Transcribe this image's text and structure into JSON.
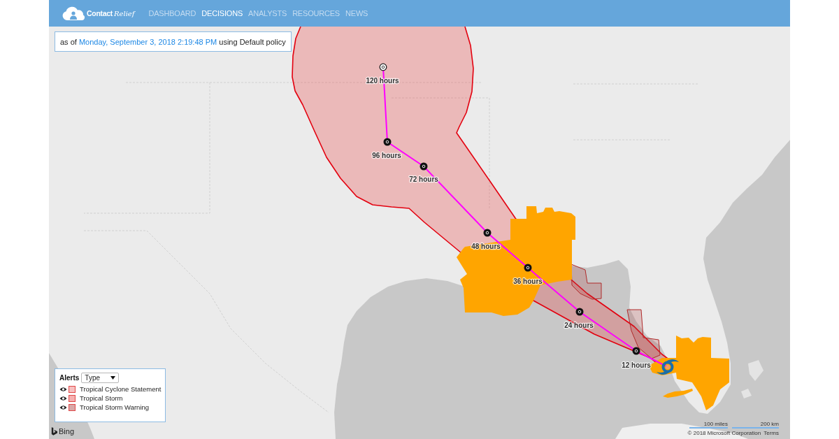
{
  "header": {
    "logo": {
      "first": "Contact",
      "second": "Relief"
    },
    "nav": [
      {
        "label": "DASHBOARD",
        "selected": false
      },
      {
        "label": "DECISIONS",
        "selected": true
      },
      {
        "label": "ANALYSTS",
        "selected": false
      },
      {
        "label": "RESOURCES",
        "selected": false
      },
      {
        "label": "NEWS",
        "selected": false
      }
    ]
  },
  "status": {
    "prefix": "as of",
    "timestamp": "Monday, September 3, 2018 2:19:48 PM",
    "suffix": "using Default policy"
  },
  "map": {
    "forecast_points": [
      {
        "label": "120 hours",
        "kind": "depression"
      },
      {
        "label": "96 hours",
        "kind": "storm"
      },
      {
        "label": "72 hours",
        "kind": "storm"
      },
      {
        "label": "48 hours",
        "kind": "storm"
      },
      {
        "label": "36 hours",
        "kind": "storm"
      },
      {
        "label": "24 hours",
        "kind": "storm"
      },
      {
        "label": "12 hours",
        "kind": "storm"
      }
    ],
    "provider": "Bing",
    "scale": [
      {
        "label": "100 miles"
      },
      {
        "label": "200 km"
      }
    ],
    "copyright": "© 2018 Microsoft Corporation",
    "terms": "Terms"
  },
  "legend": {
    "title": "Alerts",
    "filter": {
      "value": "Type"
    },
    "items": [
      {
        "label": "Tropical Cyclone Statement",
        "visible": true,
        "color": "#f7c0c0"
      },
      {
        "label": "Tropical Storm",
        "visible": true,
        "color": "#f5b0b0"
      },
      {
        "label": "Tropical Storm Warning",
        "visible": true,
        "color": "#d8a8a8"
      }
    ]
  }
}
